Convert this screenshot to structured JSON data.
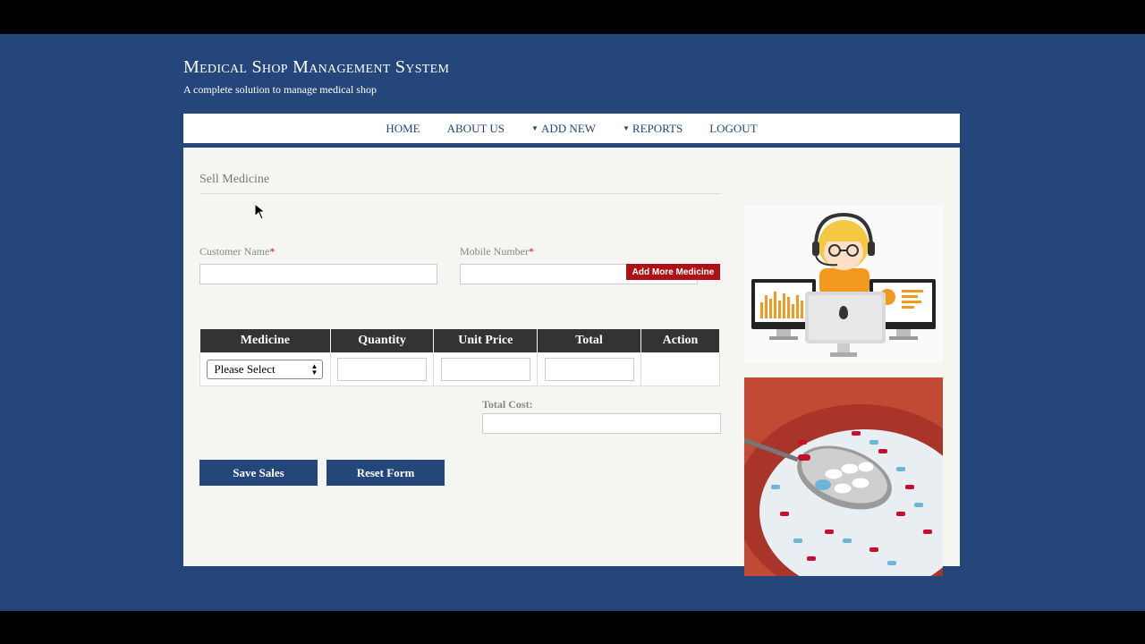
{
  "site": {
    "title": "Medical Shop Management System",
    "tagline": "A complete solution to manage medical shop"
  },
  "nav": {
    "home": "HOME",
    "about": "ABOUT US",
    "add_new": "ADD NEW",
    "reports": "REPORTS",
    "logout": "LOGOUT"
  },
  "form": {
    "title": "Sell Medicine",
    "customer_name_label": "Customer Name",
    "mobile_number_label": "Mobile Number",
    "required_mark": "*",
    "customer_name_value": "",
    "mobile_number_value": "",
    "add_more_label": "Add More Medicine",
    "total_cost_label": "Total Cost:",
    "total_cost_value": "",
    "save_label": "Save Sales",
    "reset_label": "Reset Form"
  },
  "table": {
    "headers": [
      "Medicine",
      "Quantity",
      "Unit Price",
      "Total",
      "Action"
    ],
    "rows": [
      {
        "medicine": "Please Select",
        "quantity": "",
        "unit_price": "",
        "total": ""
      }
    ]
  },
  "colors": {
    "brand_blue": "#24467a",
    "accent_red": "#b01118",
    "table_header": "#333333"
  },
  "icons": {
    "nav_dropdown": "caret-down-icon",
    "select_arrows": "updown-arrows-icon",
    "cursor": "mouse-pointer-icon"
  }
}
